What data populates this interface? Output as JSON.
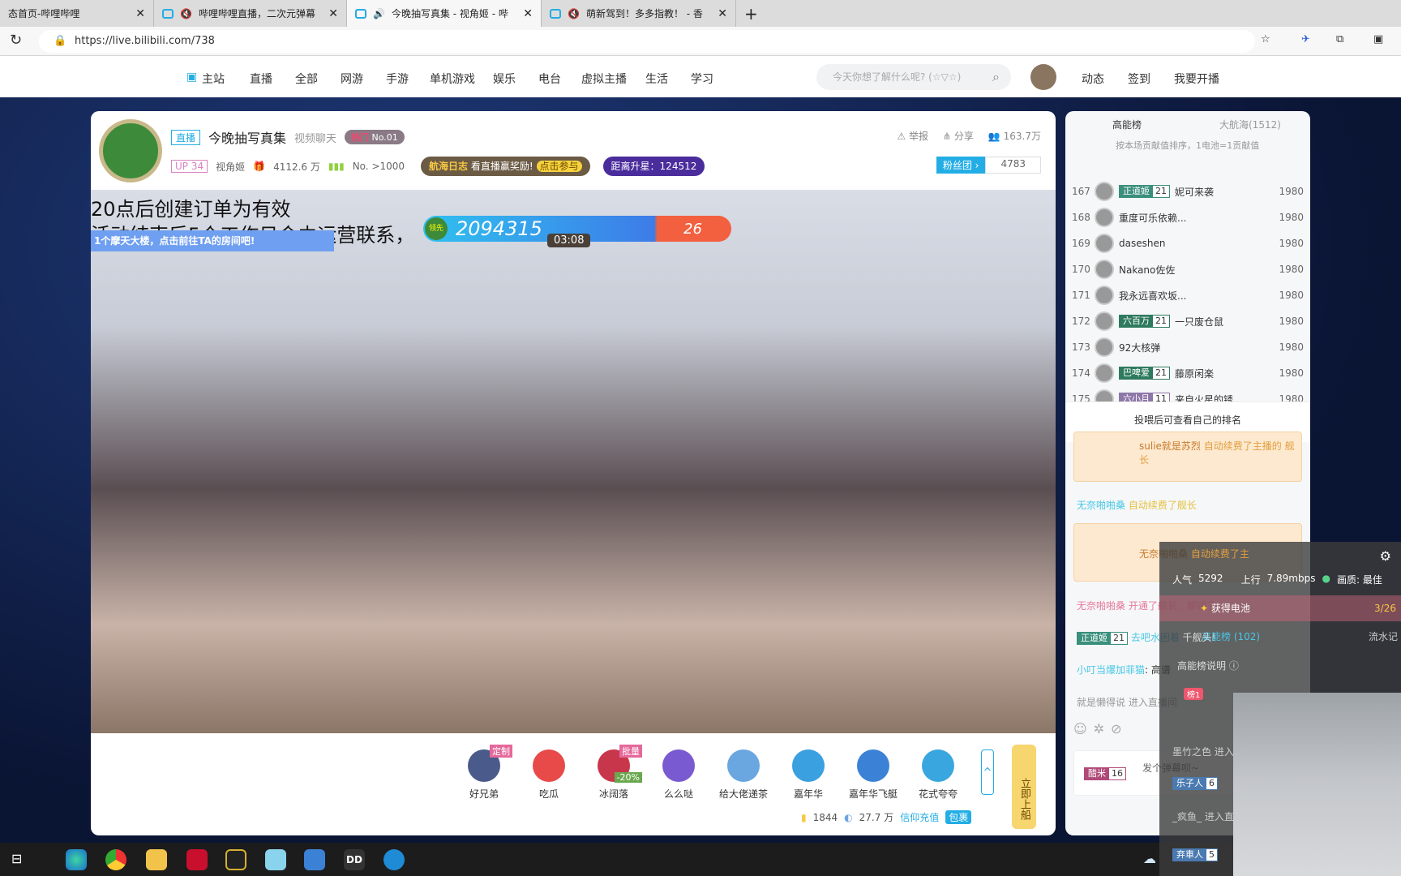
{
  "browser": {
    "tabs": [
      {
        "title": "态首页-哔哩哔哩"
      },
      {
        "title": "哔哩哔哩直播，二次元弹幕"
      },
      {
        "title": "今晚抽写真集 - 视角姬 - 哔"
      },
      {
        "title": "萌新驾到！多多指教！ - 香"
      }
    ],
    "url": "https://live.bilibili.com/738"
  },
  "nav": {
    "items": [
      "主站",
      "直播",
      "全部",
      "网游",
      "手游",
      "单机游戏",
      "娱乐",
      "电台",
      "虚拟主播",
      "生活",
      "学习"
    ],
    "search_placeholder": "今天你想了解什么呢? (☆▽☆)",
    "right": [
      "动态",
      "签到",
      "我要开播"
    ]
  },
  "room": {
    "live_badge": "直播",
    "title": "今晚抽写真集",
    "category": "视频聊天",
    "hot": "热门",
    "hot_rank": "No.01",
    "up_level": "UP 34",
    "anchor": "视角姬",
    "gifts": "4112.6 万",
    "rank": "No. >1000",
    "voyage_tag": "航海日志",
    "voyage_text": "看直播赢奖励!",
    "voyage_btn": "点击参与",
    "star": "距离升星：124512",
    "report": "举报",
    "share": "分享",
    "viewers": "163.7万",
    "fans_label": "粉丝团 ›",
    "fans": "4783"
  },
  "video": {
    "sub1": "20点后创建订单为有效",
    "sub2": "活动结束后5个工作日会由运营联系，",
    "notice": "1个摩天大楼，点击前往TA的房间吧!",
    "pk_lead": "领先",
    "pk_score": "2094315",
    "pk_timer": "03:08",
    "pk_other": "26"
  },
  "gifts": {
    "items": [
      {
        "name": "好兄弟",
        "tag": "定制"
      },
      {
        "name": "吃瓜"
      },
      {
        "name": "冰阔落",
        "tag": "批量",
        "discount": "-20%"
      },
      {
        "name": "么么哒"
      },
      {
        "name": "给大佬递茶"
      },
      {
        "name": "嘉年华"
      },
      {
        "name": "嘉年华飞艇"
      },
      {
        "name": "花式夸夸"
      }
    ],
    "battery": "1844",
    "coins": "27.7 万",
    "recharge": "信仰充值",
    "bag": "包裹",
    "board": "立即上船"
  },
  "ranking": {
    "tabs": [
      "高能榜",
      "大航海(1512)"
    ],
    "desc": "按本场贡献值排序，1电池=1贡献值",
    "rows": [
      {
        "n": "167",
        "medal": "正道姬",
        "lv": "21",
        "name": "妮可来袭",
        "score": "1980",
        "c": "#3a8f7d"
      },
      {
        "n": "168",
        "name": "重度可乐依赖...",
        "score": "1980"
      },
      {
        "n": "169",
        "name": "daseshen",
        "score": "1980"
      },
      {
        "n": "170",
        "name": "Nakano佐佐",
        "score": "1980"
      },
      {
        "n": "171",
        "name": "我永远喜欢坂...",
        "score": "1980"
      },
      {
        "n": "172",
        "medal": "六百万",
        "lv": "21",
        "name": "一只废仓鼠",
        "score": "1980",
        "c": "#2e7a5e"
      },
      {
        "n": "173",
        "name": "92大核弹",
        "score": "1980"
      },
      {
        "n": "174",
        "medal": "巴啤爱",
        "lv": "21",
        "name": "藤原闲楽",
        "score": "1980",
        "c": "#2e7a5e"
      },
      {
        "n": "175",
        "medal": "六小月",
        "lv": "11",
        "name": "来自火星的锈",
        "score": "1980",
        "c": "#8e76a8"
      }
    ],
    "footer": "投喂后可查看自己的排名"
  },
  "chat": {
    "m1_user": "sulie就是苏烈",
    "m1_text": "自动续费了主播的 舰长",
    "m2_user": "无奈啪啪桑",
    "m2_text": "自动续费了舰长",
    "m3_user": "无奈啪啪桑",
    "m3_text": "自动续费了主",
    "m4": "无奈啪啪桑 开通了舰长，解锁了...",
    "m5_medal": "正道姬",
    "m5_lv": "21",
    "m5_user": "去吧水困着",
    "m5_text": "千舰头!",
    "m6_user": "小叮当爆加菲猫",
    "m6_text": "高谱",
    "m7": "就是懒得说 进入直播间",
    "input_medal": "醋米",
    "input_lv": "16",
    "placeholder": "发个弹幕呗~"
  },
  "overlay": {
    "pop_label": "人气",
    "pop": "5292",
    "up_label": "上行",
    "up": "7.89mbps",
    "quality": "画质: 最佳",
    "battery": "获得电池",
    "battery_count": "3/26",
    "tab1": "高能榜 (102)",
    "tab2": "流水记",
    "explain": "高能榜说明",
    "rank_badge": "榜1",
    "e1": "墨竹之色 进入",
    "e2_medal": "乐子人",
    "e2_lv": "6",
    "e3": "_疯鱼_ 进入直",
    "e4_medal": "弃車人",
    "e4_lv": "5"
  },
  "colors": {
    "accent": "#23ade5",
    "pink": "#fb7299"
  }
}
